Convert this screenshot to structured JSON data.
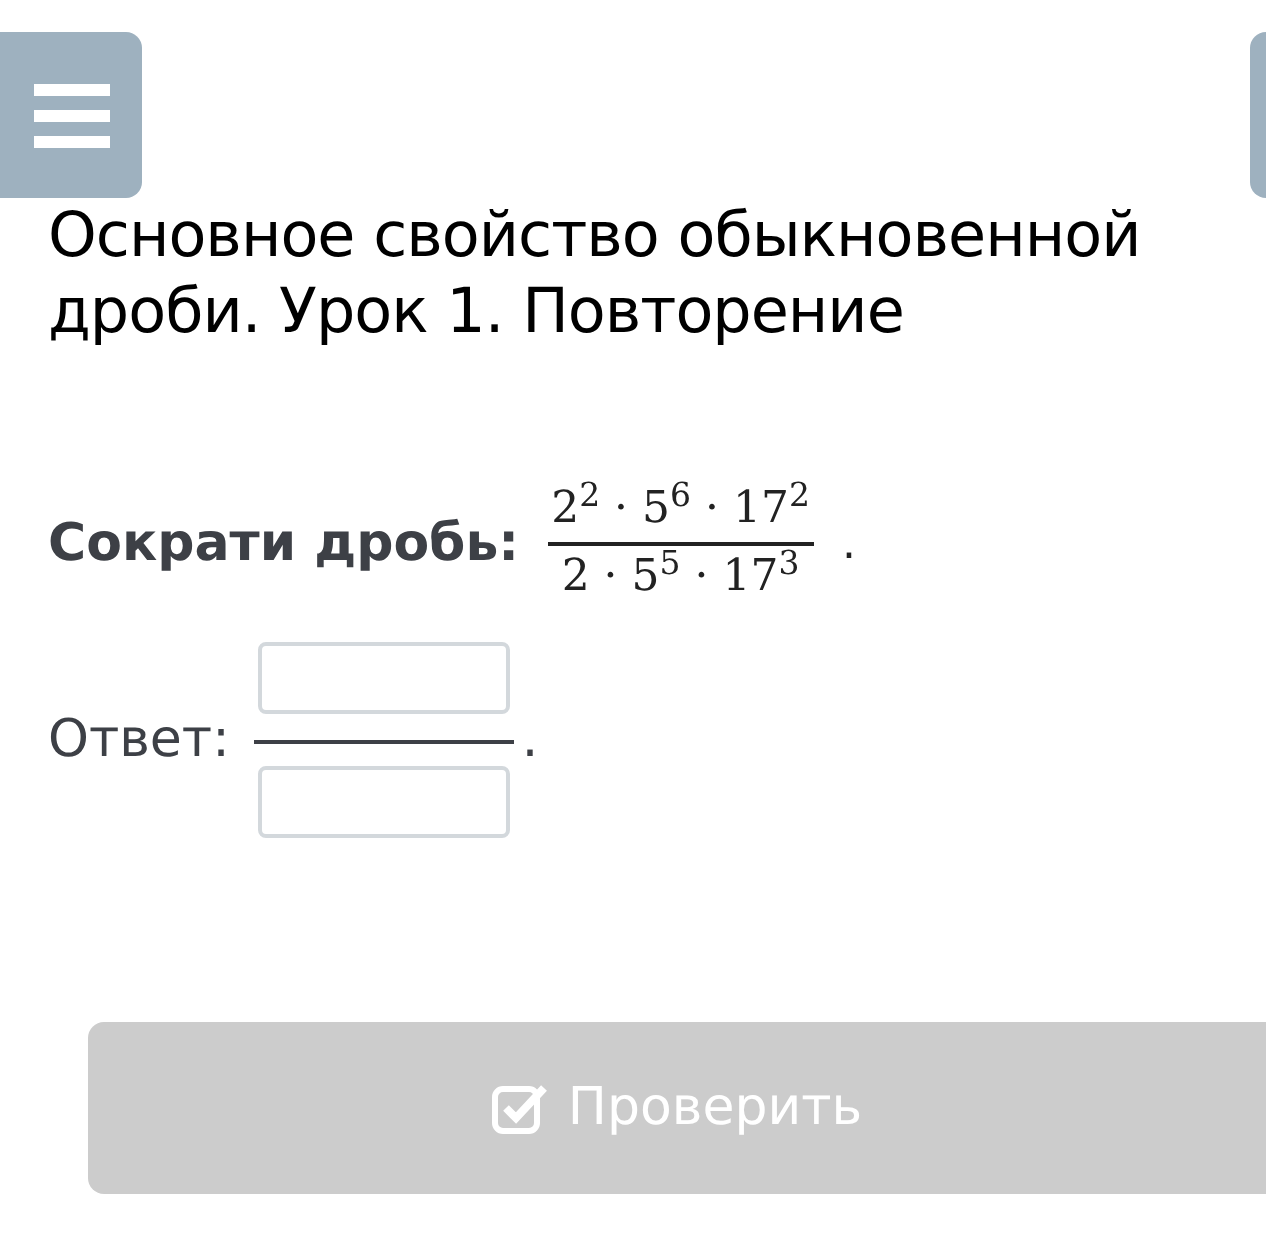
{
  "title": "Основное свойство обыкновенной дроби. Урок 1. Повторение",
  "task": {
    "label": "Сократи дробь:",
    "numerator": "2$^{2}$ · 5$^{6}$ · 17$^{2}$",
    "denominator": "2 · 5$^{5}$ · 17$^{3}$",
    "end": "."
  },
  "answer": {
    "label": "Ответ:",
    "end": "."
  },
  "check_button": {
    "label": "Проверить",
    "disabled": true
  }
}
